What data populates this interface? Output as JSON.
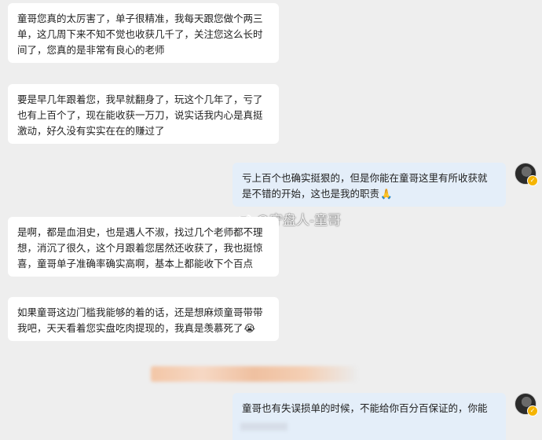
{
  "messages": [
    {
      "text": "童哥您真的太厉害了，单子很精准，我每天跟您做个两三单，这几周下来不知不觉也收获几千了，关注您这么长时间了，您真的是非常有良心的老师",
      "emoji": ""
    },
    {
      "text": "要是早几年跟着您，我早就翻身了，玩这个几年了，亏了也有上百个了，现在能收获一万刀，说实话我内心是真挺激动，好久没有实实在在的赚过了",
      "emoji": ""
    },
    {
      "text": "亏上百个也确实挺狠的，但是你能在童哥这里有所收获就是不错的开始，这也是我的职责",
      "emoji": "🙏"
    },
    {
      "text": "是啊，都是血泪史，也是遇人不淑，找过几个老师都不理想，消沉了很久，这个月跟着您居然还收获了，我也挺惊喜，童哥单子准确率确实高啊，基本上都能收下个百点",
      "emoji": ""
    },
    {
      "text": "如果童哥这边门槛我能够的着的话，还是想麻烦童哥带带我吧，天天看着您实盘吃肉提现的，我真是羡慕死了",
      "emoji": "😭"
    },
    {
      "text": "童哥也有失误损单的时候，不能给你百分百保证的，你能",
      "emoji": ""
    }
  ],
  "watermark": "@守盘人-童哥",
  "avatar_badge": "✓",
  "colors": {
    "background": "#eeeeee",
    "incoming_bubble": "#ffffff",
    "outgoing_bubble": "#e4eef9",
    "text": "#222222"
  }
}
